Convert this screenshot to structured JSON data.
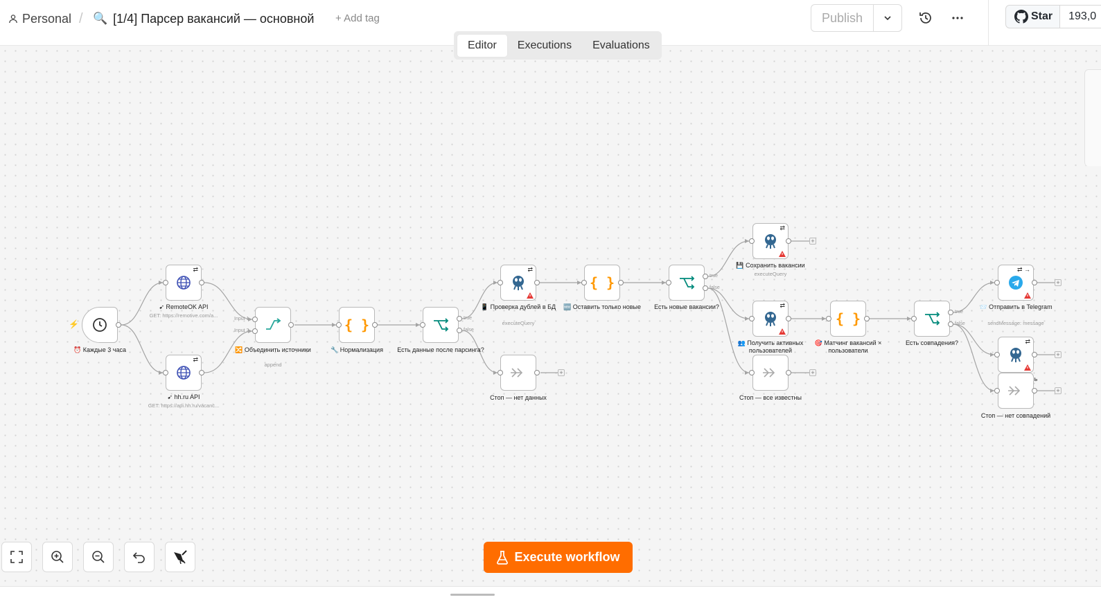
{
  "header": {
    "project": "Personal",
    "separator": "/",
    "workflow_emoji": "🔍",
    "workflow_name": "[1/4] Парсер вакансий — основной",
    "add_tag": "+ Add tag",
    "publish": "Publish",
    "github_star": "Star",
    "github_count": "193,0"
  },
  "tabs": [
    "Editor",
    "Executions",
    "Evaluations"
  ],
  "active_tab": "Editor",
  "nodes": [
    {
      "id": "schedule",
      "icon": "clock-icon",
      "label_icon": "⏰",
      "label": "Каждые 3 часа",
      "sub": ""
    },
    {
      "id": "remoteok",
      "icon": "globe-icon",
      "label_icon": "➹",
      "label": "RemoteOK API",
      "sub": "GET: https://remotive.com/a..."
    },
    {
      "id": "hhru",
      "icon": "globe-icon",
      "label_icon": "➹",
      "label": "hh.ru API",
      "sub": "GET: https://api.hh.ru/vacanc..."
    },
    {
      "id": "merge",
      "icon": "merge-icon",
      "label_icon": "🔀",
      "label": "Объединить источники",
      "sub": "append"
    },
    {
      "id": "normalize",
      "icon": "code-icon",
      "label_icon": "🔧",
      "label": "Нормализация",
      "sub": ""
    },
    {
      "id": "if_data",
      "icon": "if-icon",
      "label_icon": "",
      "label": "Есть данные после парсинга?",
      "sub": ""
    },
    {
      "id": "stop_nodata",
      "icon": "noop-icon",
      "label_icon": "",
      "label": "Стоп — нет данных",
      "sub": ""
    },
    {
      "id": "check_dupes",
      "icon": "postgres-icon",
      "label_icon": "📱",
      "label": "Проверка дублей в БД",
      "sub": "executeQuery"
    },
    {
      "id": "keep_new",
      "icon": "code-icon",
      "label_icon": "🆕",
      "label": "Оставить только новые",
      "sub": ""
    },
    {
      "id": "if_new",
      "icon": "if-icon",
      "label_icon": "",
      "label": "Есть новые вакансии?",
      "sub": ""
    },
    {
      "id": "save_vac",
      "icon": "postgres-icon",
      "label_icon": "💾",
      "label": "Сохранить вакансии",
      "sub": "executeQuery"
    },
    {
      "id": "get_users",
      "icon": "postgres-icon",
      "label_icon": "👥",
      "label": "Получить активных пользователей",
      "sub": ""
    },
    {
      "id": "stop_known",
      "icon": "noop-icon",
      "label_icon": "",
      "label": "Стоп — все известны",
      "sub": ""
    },
    {
      "id": "matching",
      "icon": "code-icon",
      "label_icon": "🎯",
      "label": "Матчинг вакансий × пользователи",
      "sub": ""
    },
    {
      "id": "if_match",
      "icon": "if-icon",
      "label_icon": "",
      "label": "Есть совпадения?",
      "sub": ""
    },
    {
      "id": "telegram",
      "icon": "telegram-icon",
      "label_icon": "📨",
      "label": "Отправить в Telegram",
      "sub": "sendMessage: message"
    },
    {
      "id": "pg_last",
      "icon": "postgres-icon",
      "label_icon": "",
      "label": "ь",
      "sub": ""
    },
    {
      "id": "stop_nomatch",
      "icon": "noop-icon",
      "label_icon": "",
      "label": "Стоп — нет совпадений",
      "sub": ""
    }
  ],
  "port_labels": {
    "input1": "Input 1",
    "input2": "Input 2",
    "true": "true",
    "false": "false"
  },
  "controls": [
    "zoom-to-fit",
    "zoom-in",
    "zoom-out",
    "reset-zoom",
    "tidy-up"
  ],
  "execute_button": "Execute workflow",
  "colors": {
    "accent": "#ff6d00",
    "if_teal": "#00897b",
    "code_orange": "#ff9800",
    "globe_blue": "#3f51b5",
    "warning_red": "#e53935"
  }
}
